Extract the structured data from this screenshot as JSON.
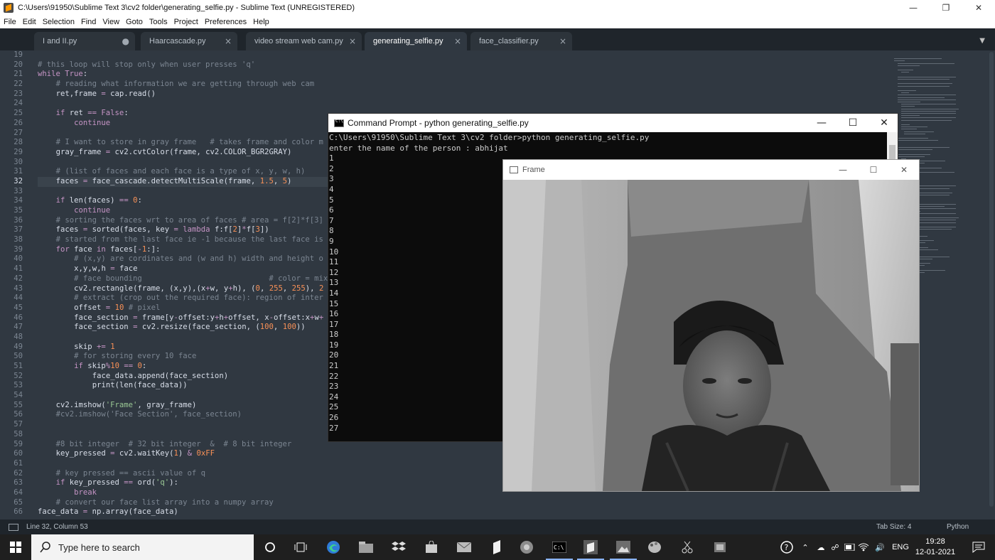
{
  "window": {
    "title": "C:\\Users\\91950\\Sublime Text 3\\cv2 folder\\generating_selfie.py - Sublime Text (UNREGISTERED)",
    "controls": [
      "minimize",
      "maximize",
      "close"
    ]
  },
  "menu": [
    "File",
    "Edit",
    "Selection",
    "Find",
    "View",
    "Goto",
    "Tools",
    "Project",
    "Preferences",
    "Help"
  ],
  "tabs": [
    {
      "label": "I and II.py",
      "close": "●"
    },
    {
      "label": "Haarcascade.py",
      "close": "×"
    },
    {
      "label": "video stream web cam.py",
      "close": "×"
    },
    {
      "label": "generating_selfie.py",
      "close": "×",
      "active": true
    },
    {
      "label": "face_classifier.py",
      "close": "×"
    }
  ],
  "editor": {
    "current_line": "32",
    "line_numbers": [
      "19",
      "20",
      "21",
      "22",
      "23",
      "24",
      "25",
      "26",
      "27",
      "28",
      "29",
      "30",
      "31",
      "32",
      "33",
      "34",
      "35",
      "36",
      "37",
      "38",
      "39",
      "40",
      "41",
      "42",
      "43",
      "44",
      "45",
      "46",
      "47",
      "48",
      "49",
      "50",
      "51",
      "52",
      "53",
      "54",
      "55",
      "56",
      "57",
      "58",
      "59",
      "60",
      "61",
      "62",
      "63",
      "64",
      "65",
      "66"
    ],
    "lines": [
      "",
      "# this loop will stop only when user presses 'q'",
      "while True:",
      "    # reading what information we are getting through web cam",
      "    ret,frame = cap.read()",
      "",
      "    if ret == False:",
      "        continue",
      "",
      "    # I want to store in gray frame   # takes frame and color m",
      "    gray_frame = cv2.cvtColor(frame, cv2.COLOR_BGR2GRAY)",
      "",
      "    # (list of faces and each face is a type of x, y, w, h)",
      "    faces = face_cascade.detectMultiScale(frame, 1.5, 5)",
      "",
      "    if len(faces) == 0:",
      "        continue",
      "    # sorting the faces wrt to area of faces # area = f[2]*f[3]",
      "    faces = sorted(faces, key = lambda f:f[2]*f[3])",
      "    # started from the last face ie -1 because the last face is",
      "    for face in faces[-1:]:",
      "        # (x,y) are cordinates and (w and h) width and height o",
      "        x,y,w,h = face",
      "        # face bounding                            # color = mixtu",
      "        cv2.rectangle(frame, (x,y),(x+w, y+h), (0, 255, 255), 2",
      "        # extract (crop out the required face): region of inter",
      "        offset = 10 # pixel",
      "        face_section = frame[y-offset:y+h+offset, x-offset:x+w+",
      "        face_section = cv2.resize(face_section, (100, 100))",
      "",
      "        skip += 1",
      "        # for storing every 10 face",
      "        if skip%10 == 0:",
      "            face_data.append(face_section)",
      "            print(len(face_data))",
      "",
      "    cv2.imshow('Frame', gray_frame)",
      "    #cv2.imshow('Face Section', face_section)",
      "",
      "",
      "    #8 bit integer  # 32 bit integer  &  # 8 bit integer",
      "    key_pressed = cv2.waitKey(1) & 0xFF",
      "",
      "    # key pressed == ascii value of q",
      "    if key_pressed == ord('q'):",
      "        break",
      "    # convert our face list array into a numpy array",
      "face_data = np.array(face_data)"
    ]
  },
  "status": {
    "position": "Line 32, Column 53",
    "tab_size": "Tab Size: 4",
    "syntax": "Python"
  },
  "cmd": {
    "title": "Command Prompt - python  generating_selfie.py",
    "lines": [
      "C:\\Users\\91950\\Sublime Text 3\\cv2 folder>python generating_selfie.py",
      "enter the name of the person : abhijat",
      "1",
      "2",
      "3",
      "4",
      "5",
      "6",
      "7",
      "8",
      "9",
      "10",
      "11",
      "12",
      "13",
      "14",
      "15",
      "16",
      "17",
      "18",
      "19",
      "20",
      "21",
      "22",
      "23",
      "24",
      "25",
      "26",
      "27"
    ]
  },
  "frame_window": {
    "title": "Frame",
    "image": "grayscale webcam frame showing a man's face"
  },
  "taskbar": {
    "search_placeholder": "Type here to search",
    "apps": [
      "task-view-icon",
      "edge-icon",
      "file-explorer-icon",
      "dropbox-icon",
      "store-icon",
      "mail-icon",
      "sublime-taskbar-icon",
      "chrome-icon",
      "cmd-taskbar-icon",
      "sublime-active-icon",
      "photos-icon",
      "paint-icon",
      "snip-icon",
      "stack-icon"
    ],
    "language": "ENG",
    "time": "19:28",
    "date": "12-01-2021"
  },
  "colors": {
    "editor_bg": "#303841",
    "comment": "#7b8591",
    "keyword": "#c594c5",
    "string": "#99c794",
    "number": "#f99157",
    "text": "#d8dee9"
  }
}
